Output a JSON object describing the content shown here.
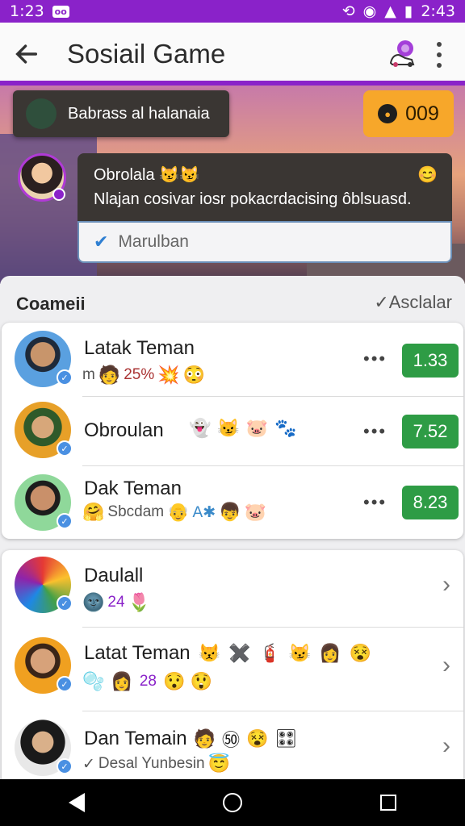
{
  "status_bar": {
    "time_left": "1:23",
    "badge": "oo",
    "time_right": "2:43",
    "icons": [
      "sync-icon",
      "wifi-icon",
      "signal-icon",
      "battery-icon"
    ]
  },
  "app_bar": {
    "title": "Sosiail Game",
    "back_icon": "arrow-left-icon",
    "app_icon": "game-controller-icon",
    "more_icon": "more-vertical-icon"
  },
  "toast": {
    "text": "Babrass al halanaia"
  },
  "coins": {
    "value": "009",
    "icon": "coin-icon"
  },
  "chat": {
    "sender": "Obrolala 😼😼",
    "sender_emoji": "😊",
    "message": "Nlajan cosivar iosr pokacrdacising ôblsuasd.",
    "reply": "Marulban",
    "reply_icon": "check-icon"
  },
  "section": {
    "title": "Coameii",
    "action": "Asclalar",
    "action_icon": "check-icon"
  },
  "ranked_friends": [
    {
      "name": "Latak Teman",
      "meta_text": "m",
      "meta_text2": "25%",
      "emojis_before": [
        "🧑"
      ],
      "emojis_after": [
        "💥",
        "😳"
      ],
      "score": "1.33",
      "more": "•••"
    },
    {
      "name": "Obroulan",
      "meta_text": "",
      "meta_text2": "",
      "emojis_before": [],
      "emojis_after": [
        "👻",
        "😼",
        "🐷",
        "🐾"
      ],
      "score": "7.52",
      "more": "•••"
    },
    {
      "name": "Dak Teman",
      "meta_text": "Sbcdam",
      "meta_text2": "A✱",
      "emojis_before": [
        "🤗"
      ],
      "emojis_after": [
        "👴",
        "👦",
        "🐷"
      ],
      "score": "8.23",
      "more": "•••"
    }
  ],
  "friends": [
    {
      "name": "Daulall",
      "meta_emojis": [
        "🌚"
      ],
      "meta_text": "24",
      "meta_trailing": "🌷"
    },
    {
      "name": "Latat Teman",
      "name_emojis": [
        "😾",
        "✖️",
        "🧯",
        "😼",
        "👩",
        "😵"
      ],
      "meta_emojis": [
        "🫧",
        "👩"
      ],
      "meta_text": "28",
      "meta_trailing": "😯 😲"
    },
    {
      "name": "Dan Temain",
      "name_emojis": [
        "🧑",
        "㊿",
        "😵",
        "🎛"
      ],
      "meta_check": "✓",
      "meta_text": "Desal Yunbesin",
      "meta_trailing": "😇"
    }
  ],
  "colors": {
    "accent": "#8a22c9",
    "score_green": "#2e9c45",
    "coin_orange": "#f7a72a"
  },
  "nav": {
    "back_icon": "nav-back-icon",
    "home_icon": "nav-home-icon",
    "recent_icon": "nav-recent-icon"
  }
}
